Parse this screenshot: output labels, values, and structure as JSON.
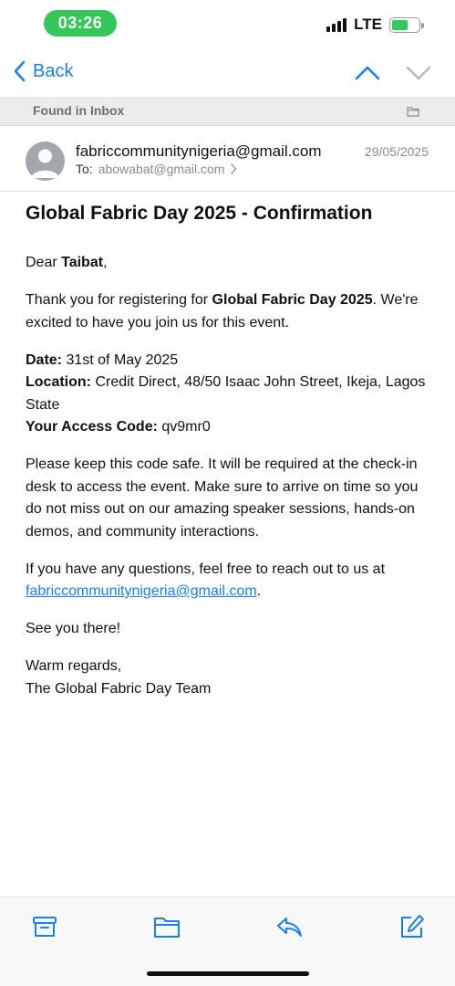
{
  "status": {
    "time": "03:26",
    "network": "LTE",
    "battery_level": 0.6,
    "accent": "#34c759"
  },
  "nav": {
    "back_label": "Back",
    "up_icon": "chevron-up-icon",
    "down_icon": "chevron-down-icon",
    "link_color": "#1a7ff0"
  },
  "found": {
    "text": "Found in Inbox",
    "icon": "folder-icon"
  },
  "header": {
    "sender": "fabriccommunitynigeria@gmail.com",
    "to_label": "To:",
    "to_address": "abowabat@gmail.com",
    "date": "29/05/2025"
  },
  "email": {
    "subject": "Global Fabric Day 2025 - Confirmation",
    "greeting_prefix": "Dear ",
    "greeting_name": "Taibat",
    "greeting_suffix": ",",
    "p1_prefix": "Thank you for registering for ",
    "p1_bold": "Global Fabric Day 2025",
    "p1_suffix": ". We're excited to have you join us for this event.",
    "date_label": "Date:",
    "date_value": " 31st of May 2025",
    "location_label": "Location:",
    "location_value": " Credit Direct, 48/50 Isaac John Street, Ikeja, Lagos State",
    "code_label": "Your Access Code:",
    "code_value": " qv9mr0",
    "p3": "Please keep this code safe. It will be required at the check-in desk to access the event. Make sure to arrive on time so you do not miss out on our amazing speaker sessions, hands-on demos, and community interactions.",
    "p4_prefix": "If you have any questions, feel free to reach out to us at ",
    "p4_link": "fabriccommunitynigeria@gmail.com",
    "p4_suffix": ".",
    "p5": "See you there!",
    "signoff1": "Warm regards,",
    "signoff2": "The Global Fabric Day Team"
  },
  "toolbar": {
    "icons": [
      "archive-icon",
      "folder-icon",
      "reply-icon",
      "compose-icon"
    ]
  }
}
